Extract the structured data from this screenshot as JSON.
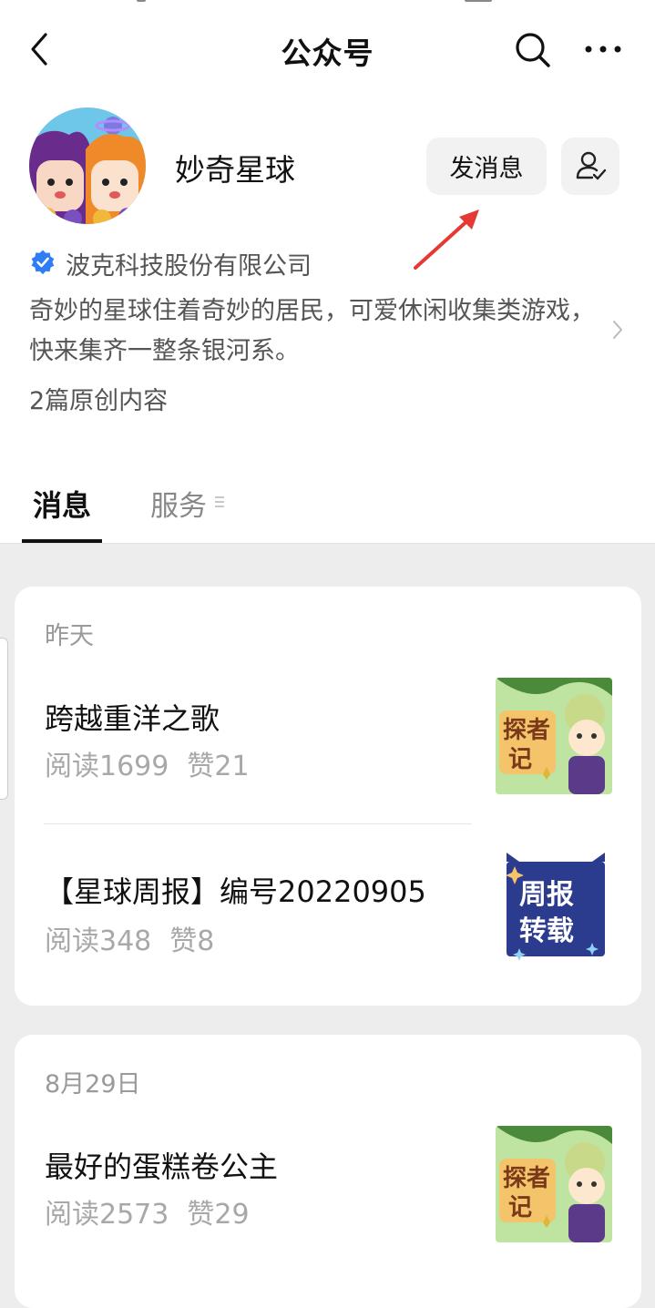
{
  "nav": {
    "title": "公众号",
    "back_icon": "back-arrow-icon",
    "search_icon": "search-icon",
    "more_icon": "more-icon"
  },
  "profile": {
    "name": "妙奇星球",
    "message_button": "发消息",
    "follow_icon": "user-check-icon",
    "company": "波克科技股份有限公司",
    "description": "奇妙的星球住着奇妙的居民，可爱休闲收集类游戏，快来集齐一整条银河系。",
    "original_count": "2篇原创内容"
  },
  "tabs": [
    {
      "label": "消息",
      "active": true
    },
    {
      "label": "服务",
      "active": false
    }
  ],
  "colors": {
    "verify_blue": "#2f7df6",
    "annotation_red": "#e53935",
    "background": "#ededed"
  },
  "groups": [
    {
      "date": "昨天",
      "articles": [
        {
          "title": "跨越重洋之歌",
          "reads": "阅读1699",
          "likes": "赞21",
          "thumb": "explorer-notes-thumbnail"
        },
        {
          "title": "【星球周报】编号20220905",
          "reads": "阅读348",
          "likes": "赞8",
          "thumb": "weekly-report-thumbnail",
          "thumb_text": [
            "周报",
            "转载"
          ]
        }
      ]
    },
    {
      "date": "8月29日",
      "articles": [
        {
          "title": "最好的蛋糕卷公主",
          "reads": "阅读2573",
          "likes": "赞29",
          "thumb": "explorer-notes-thumbnail"
        }
      ]
    }
  ]
}
